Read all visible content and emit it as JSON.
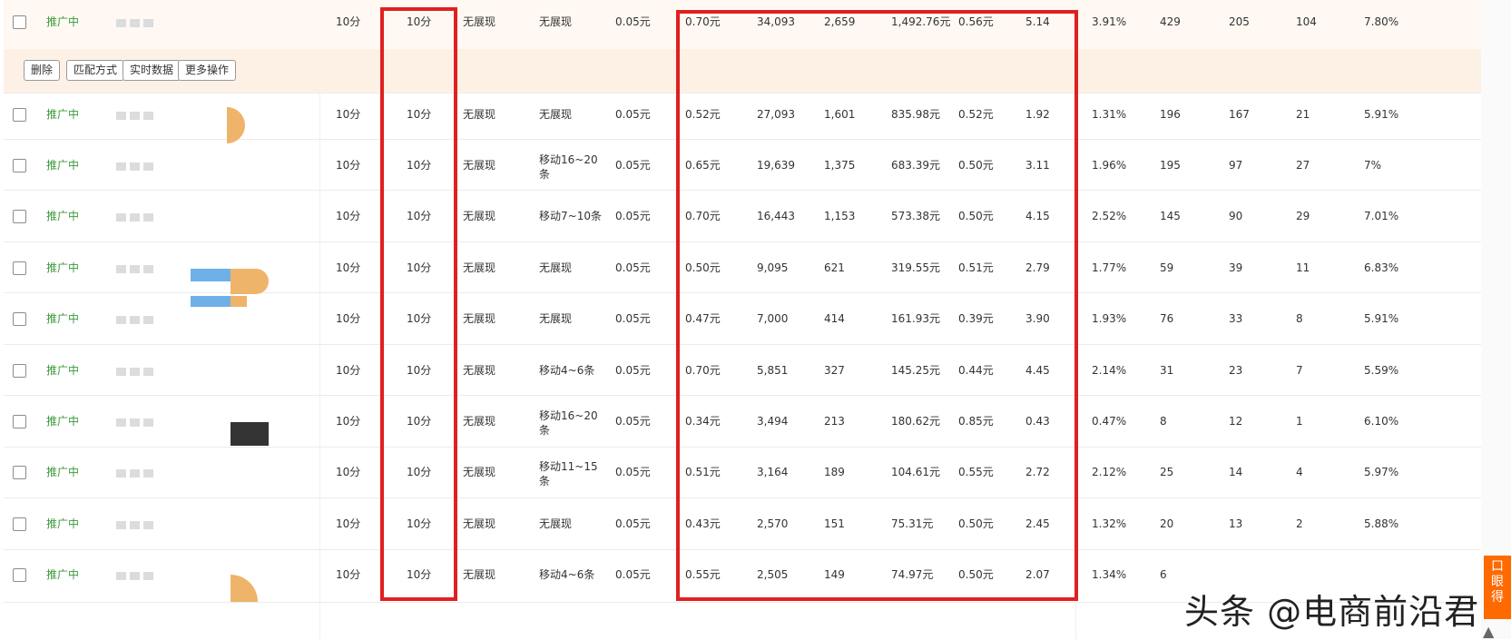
{
  "actions": [
    {
      "id": "delete",
      "label": "删除"
    },
    {
      "id": "match",
      "label": "匹配方式"
    },
    {
      "id": "realtime",
      "label": "实时数据"
    },
    {
      "id": "more",
      "label": "更多操作"
    }
  ],
  "rows": [
    {
      "status": "推广中",
      "time": "10分",
      "score": "10分",
      "pc_rank": "无展现",
      "mobile_rank": "无展现",
      "bid": "0.05元",
      "avg_cpc": "0.70元",
      "impressions": "34,093",
      "clicks": "2,659",
      "cost": "1,492.76元",
      "c1": "0.56元",
      "c2": "5.14",
      "ctr": "3.91%",
      "n1": "429",
      "n2": "205",
      "n3": "104",
      "rate": "7.80%"
    },
    {
      "status": "推广中",
      "time": "10分",
      "score": "10分",
      "pc_rank": "无展现",
      "mobile_rank": "无展现",
      "bid": "0.05元",
      "avg_cpc": "0.52元",
      "impressions": "27,093",
      "clicks": "1,601",
      "cost": "835.98元",
      "c1": "0.52元",
      "c2": "1.92",
      "ctr": "1.31%",
      "n1": "196",
      "n2": "167",
      "n3": "21",
      "rate": "5.91%"
    },
    {
      "status": "推广中",
      "time": "10分",
      "score": "10分",
      "pc_rank": "无展现",
      "mobile_rank": "移动16~20条",
      "bid": "0.05元",
      "avg_cpc": "0.65元",
      "impressions": "19,639",
      "clicks": "1,375",
      "cost": "683.39元",
      "c1": "0.50元",
      "c2": "3.11",
      "ctr": "1.96%",
      "n1": "195",
      "n2": "97",
      "n3": "27",
      "rate": "7%"
    },
    {
      "status": "推广中",
      "time": "10分",
      "score": "10分",
      "pc_rank": "无展现",
      "mobile_rank": "移动7~10条",
      "bid": "0.05元",
      "avg_cpc": "0.70元",
      "impressions": "16,443",
      "clicks": "1,153",
      "cost": "573.38元",
      "c1": "0.50元",
      "c2": "4.15",
      "ctr": "2.52%",
      "n1": "145",
      "n2": "90",
      "n3": "29",
      "rate": "7.01%"
    },
    {
      "status": "推广中",
      "time": "10分",
      "score": "10分",
      "pc_rank": "无展现",
      "mobile_rank": "无展现",
      "bid": "0.05元",
      "avg_cpc": "0.50元",
      "impressions": "9,095",
      "clicks": "621",
      "cost": "319.55元",
      "c1": "0.51元",
      "c2": "2.79",
      "ctr": "1.77%",
      "n1": "59",
      "n2": "39",
      "n3": "11",
      "rate": "6.83%"
    },
    {
      "status": "推广中",
      "time": "10分",
      "score": "10分",
      "pc_rank": "无展现",
      "mobile_rank": "无展现",
      "bid": "0.05元",
      "avg_cpc": "0.47元",
      "impressions": "7,000",
      "clicks": "414",
      "cost": "161.93元",
      "c1": "0.39元",
      "c2": "3.90",
      "ctr": "1.93%",
      "n1": "76",
      "n2": "33",
      "n3": "8",
      "rate": "5.91%"
    },
    {
      "status": "推广中",
      "time": "10分",
      "score": "10分",
      "pc_rank": "无展现",
      "mobile_rank": "移动4~6条",
      "bid": "0.05元",
      "avg_cpc": "0.70元",
      "impressions": "5,851",
      "clicks": "327",
      "cost": "145.25元",
      "c1": "0.44元",
      "c2": "4.45",
      "ctr": "2.14%",
      "n1": "31",
      "n2": "23",
      "n3": "7",
      "rate": "5.59%"
    },
    {
      "status": "推广中",
      "time": "10分",
      "score": "10分",
      "pc_rank": "无展现",
      "mobile_rank": "移动16~20条",
      "bid": "0.05元",
      "avg_cpc": "0.34元",
      "impressions": "3,494",
      "clicks": "213",
      "cost": "180.62元",
      "c1": "0.85元",
      "c2": "0.43",
      "ctr": "0.47%",
      "n1": "8",
      "n2": "12",
      "n3": "1",
      "rate": "6.10%"
    },
    {
      "status": "推广中",
      "time": "10分",
      "score": "10分",
      "pc_rank": "无展现",
      "mobile_rank": "移动11~15条",
      "bid": "0.05元",
      "avg_cpc": "0.51元",
      "impressions": "3,164",
      "clicks": "189",
      "cost": "104.61元",
      "c1": "0.55元",
      "c2": "2.72",
      "ctr": "2.12%",
      "n1": "25",
      "n2": "14",
      "n3": "4",
      "rate": "5.97%"
    },
    {
      "status": "推广中",
      "time": "10分",
      "score": "10分",
      "pc_rank": "无展现",
      "mobile_rank": "无展现",
      "bid": "0.05元",
      "avg_cpc": "0.43元",
      "impressions": "2,570",
      "clicks": "151",
      "cost": "75.31元",
      "c1": "0.50元",
      "c2": "2.45",
      "ctr": "1.32%",
      "n1": "20",
      "n2": "13",
      "n3": "2",
      "rate": "5.88%"
    },
    {
      "status": "推广中",
      "time": "10分",
      "score": "10分",
      "pc_rank": "无展现",
      "mobile_rank": "移动4~6条",
      "bid": "0.05元",
      "avg_cpc": "0.55元",
      "impressions": "2,505",
      "clicks": "149",
      "cost": "74.97元",
      "c1": "0.50元",
      "c2": "2.07",
      "ctr": "1.34%",
      "n1": "6",
      "n2": "",
      "n3": "",
      "rate": ""
    }
  ],
  "watermark": "头条 @电商前沿君",
  "side_tab": "口 眼 得",
  "colors": {
    "status_green": "#3a9a3a",
    "highlight_red": "#e02020",
    "row_highlight": "#fff8f3",
    "action_bar": "#fdf1e6",
    "side_tab": "#ff6a00"
  }
}
